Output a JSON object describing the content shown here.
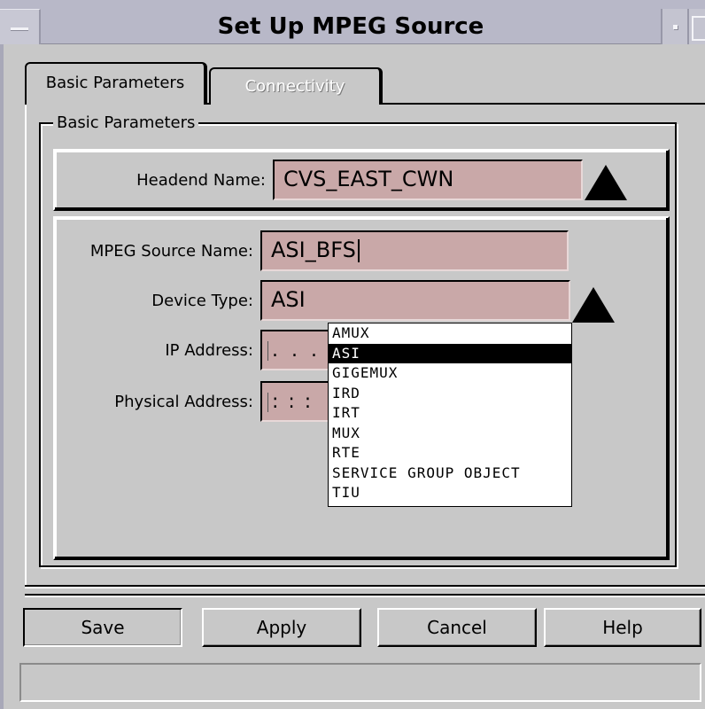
{
  "window": {
    "title": "Set Up MPEG Source"
  },
  "tabs": [
    {
      "label": "Basic Parameters",
      "active": true
    },
    {
      "label": "Connectivity",
      "active": false
    }
  ],
  "group": {
    "legend": "Basic Parameters"
  },
  "form": {
    "headend_label": "Headend Name:",
    "headend_value": "CVS_EAST_CWN",
    "mpeg_label": "MPEG Source Name:",
    "mpeg_value": "ASI_BFS",
    "device_label": "Device Type:",
    "device_value": "ASI",
    "ip_label": "IP Address:",
    "ip_value": ". . .",
    "phys_label": "Physical Address:",
    "phys_value": ": : :"
  },
  "device_options": [
    "AMUX",
    "ASI",
    "GIGEMUX",
    "IRD",
    "IRT",
    "MUX",
    "RTE",
    "SERVICE GROUP OBJECT",
    "TIU"
  ],
  "device_selected_index": 1,
  "buttons": {
    "save": "Save",
    "apply": "Apply",
    "cancel": "Cancel",
    "help": "Help"
  },
  "status": "",
  "colors": {
    "field_bg": "#c9a8a8",
    "window_bg": "#c8c8c8",
    "titlebar_bg": "#b8b8c8",
    "selected_bg": "#000000"
  },
  "icons": {
    "window_menu": "window-menu-icon",
    "minimize": "minimize-icon",
    "maximize": "maximize-icon",
    "dropdown_arrow": "triangle-up-icon"
  }
}
